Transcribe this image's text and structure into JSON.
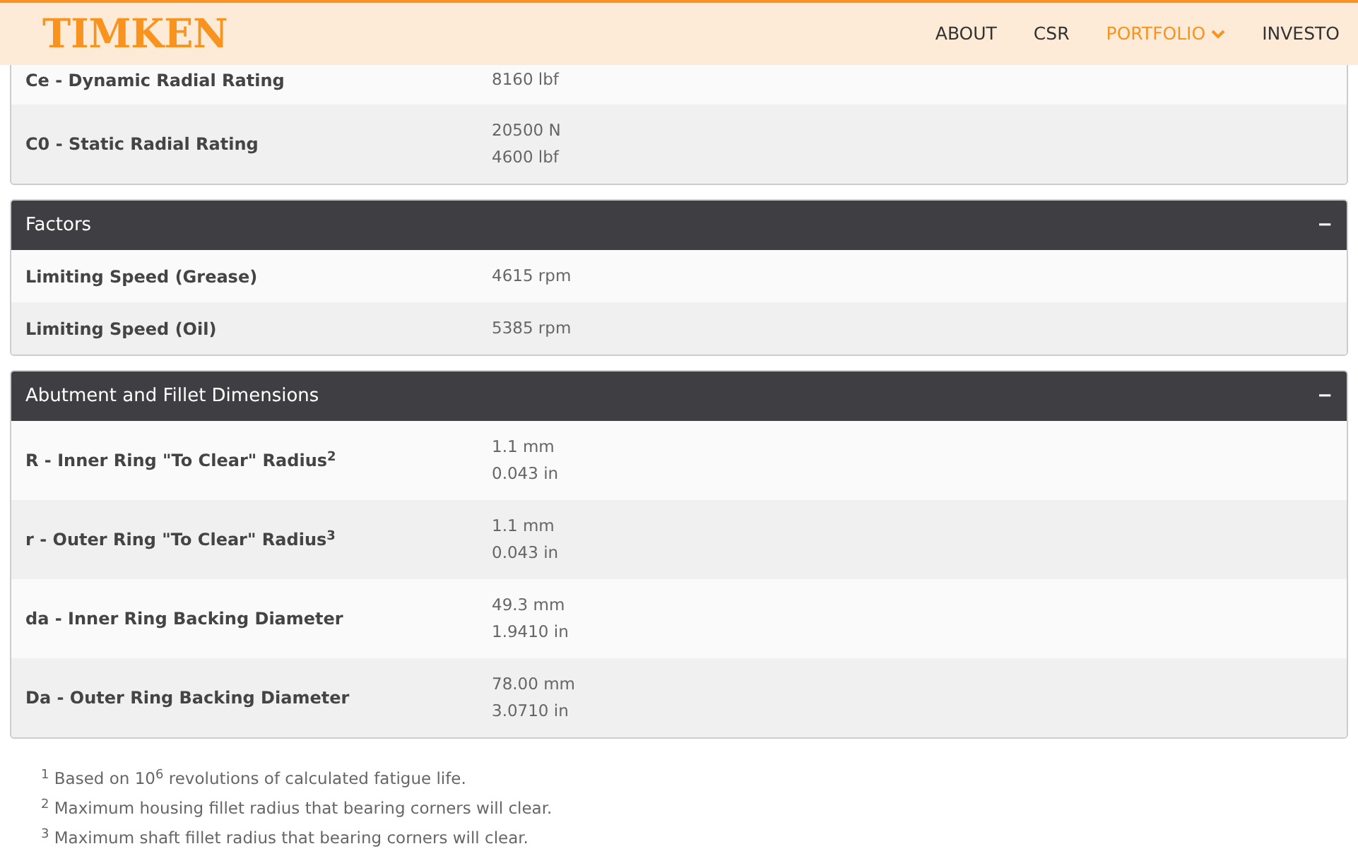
{
  "header": {
    "logo": "TIMKEN",
    "nav": [
      {
        "label": "ABOUT",
        "selected": false,
        "dropdown": false
      },
      {
        "label": "CSR",
        "selected": false,
        "dropdown": false
      },
      {
        "label": "PORTFOLIO",
        "selected": true,
        "dropdown": true
      },
      {
        "label": "INVESTO",
        "selected": false,
        "dropdown": false
      }
    ]
  },
  "sections": [
    {
      "rows": [
        {
          "label": "Ce - Dynamic Radial Rating",
          "values": [
            "8160 lbf"
          ]
        },
        {
          "label": "C0 - Static Radial Rating",
          "values": [
            "20500 N",
            "4600 lbf"
          ]
        }
      ]
    },
    {
      "title": "Factors",
      "toggle": "−",
      "rows": [
        {
          "label": "Limiting Speed (Grease)",
          "values": [
            "4615 rpm"
          ]
        },
        {
          "label": "Limiting Speed (Oil)",
          "values": [
            "5385 rpm"
          ]
        }
      ]
    },
    {
      "title": "Abutment and Fillet Dimensions",
      "toggle": "−",
      "rows": [
        {
          "label": "R - Inner Ring \"To Clear\" Radius$^{2}$",
          "values": [
            "1.1 mm",
            "0.043 in"
          ]
        },
        {
          "label": "r - Outer Ring \"To Clear\" Radius$^{3}$",
          "values": [
            "1.1 mm",
            "0.043 in"
          ]
        },
        {
          "label": "da - Inner Ring Backing Diameter",
          "values": [
            "49.3 mm",
            "1.9410 in"
          ]
        },
        {
          "label": "Da - Outer Ring Backing Diameter",
          "values": [
            "78.00 mm",
            "3.0710 in"
          ]
        }
      ]
    }
  ],
  "footnotes": [
    "$^{1}$ Based on 10$^{6}$ revolutions of calculated fatigue life.",
    "$^{2}$ Maximum housing fillet radius that bearing corners will clear.",
    "$^{3}$ Maximum shaft fillet radius that bearing corners will clear."
  ]
}
